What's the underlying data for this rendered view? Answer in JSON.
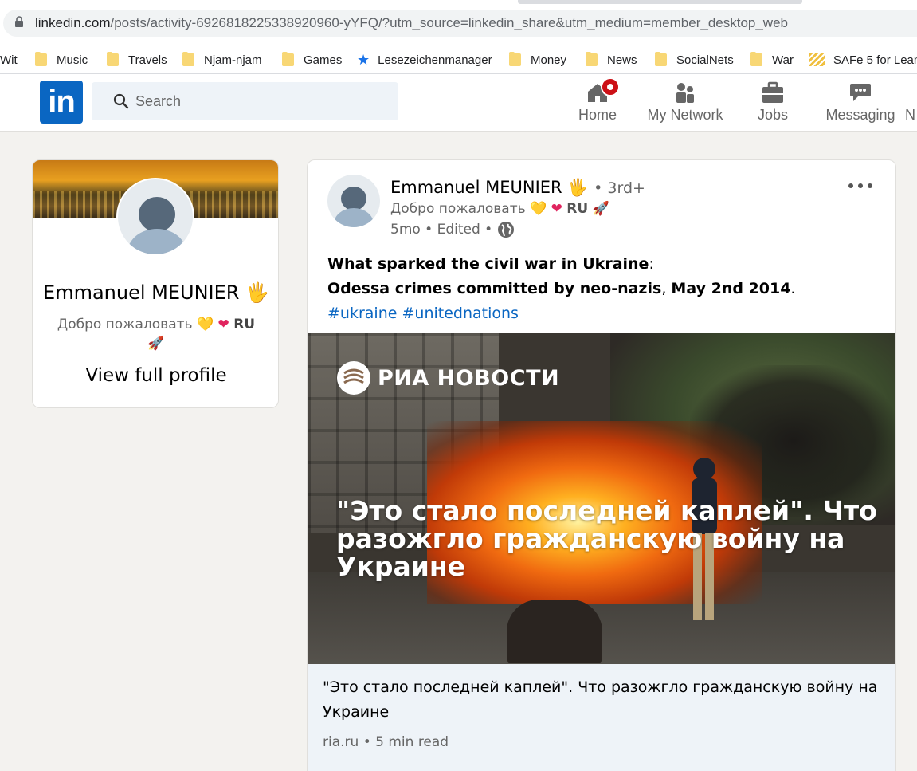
{
  "browser": {
    "url_host": "linkedin.com",
    "url_path": "/posts/activity-6926818225338920960-yYFQ/?utm_source=linkedin_share&utm_medium=member_desktop_web",
    "bookmarks": [
      {
        "label": "Wit",
        "icon": "none"
      },
      {
        "label": "Music",
        "icon": "folder-icon"
      },
      {
        "label": "Travels",
        "icon": "folder-icon"
      },
      {
        "label": "Njam-njam",
        "icon": "folder-icon"
      },
      {
        "label": "Games",
        "icon": "folder-icon"
      },
      {
        "label": "Lesezeichenmanager",
        "icon": "star-icon"
      },
      {
        "label": "Money",
        "icon": "folder-icon"
      },
      {
        "label": "News",
        "icon": "folder-icon"
      },
      {
        "label": "SocialNets",
        "icon": "folder-icon"
      },
      {
        "label": "War",
        "icon": "folder-icon"
      },
      {
        "label": "SAFe 5 for Lean",
        "icon": "safe-icon"
      }
    ]
  },
  "header": {
    "logo_text": "in",
    "search_placeholder": "Search",
    "nav": [
      {
        "label": "Home",
        "icon": "home-icon"
      },
      {
        "label": "My Network",
        "icon": "network-icon"
      },
      {
        "label": "Jobs",
        "icon": "briefcase-icon"
      },
      {
        "label": "Messaging",
        "icon": "message-icon"
      },
      {
        "label": "N",
        "icon": "bell-icon"
      }
    ],
    "brand_color": "#0a66c2",
    "badge_color": "#cc1016"
  },
  "profile_card": {
    "name": "Emmanuel MEUNIER 🖐",
    "tagline_text": "Добро пожаловать",
    "tagline_emoji_1": "💛",
    "tagline_emoji_2": "❤",
    "tagline_code": "RU",
    "tagline_emoji_3": "🚀",
    "view_profile_label": "View full profile"
  },
  "post": {
    "author_name": "Emmanuel MEUNIER 🖐",
    "author_degree": "• 3rd+",
    "author_tagline_text": "Добро пожаловать",
    "author_tagline_emoji_1": "💛",
    "author_tagline_emoji_2": "❤",
    "author_tagline_code": "RU",
    "author_tagline_emoji_3": "🚀",
    "meta": "5mo • Edited •",
    "text_line1_bold": "What sparked the civil war in Ukraine",
    "text_line1_rest": ":",
    "text_line2_a": "Odessa crimes committed by neo-nazis",
    "text_line2_sep": ", ",
    "text_line2_b": "May 2nd 2014",
    "text_line2_end": ".",
    "hashtag_1": "#ukraine",
    "hashtag_2": "#unitednations",
    "image_logo_text": "РИА НОВОСТИ",
    "image_headline": "\"Это стало последней каплей\". Что разожгло гражданскую войну на Украине",
    "article_title": "\"Это стало последней каплей\". Что разожгло гражданскую войну на Украине",
    "article_source": "ria.ru • 5 min read"
  }
}
